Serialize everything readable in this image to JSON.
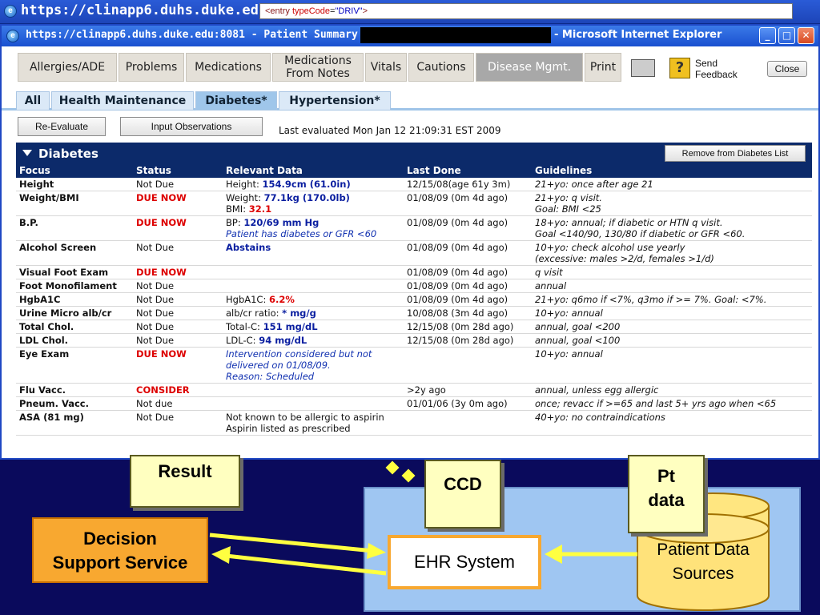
{
  "background_window": {
    "url": "https://clinapp6.duhs.duke.edu:808"
  },
  "tooltip": {
    "tag_open": "<entry",
    "attr": " typeCode",
    "equals": "=",
    "value": "\"DRIV\"",
    "tag_close": ">"
  },
  "window": {
    "title": "https://clinapp6.duhs.duke.edu:8081 - Patient Summary for",
    "title_suffix": "- Microsoft Internet Explorer"
  },
  "main_tabs": [
    "Allergies/ADE",
    "Problems",
    "Medications",
    "Medications From Notes",
    "Vitals",
    "Cautions",
    "Disease Mgmt.",
    "Print"
  ],
  "toolbar": {
    "send_feedback": "Send Feedback",
    "close": "Close"
  },
  "sub_tabs": [
    "All",
    "Health Maintenance",
    "Diabetes*",
    "Hypertension*"
  ],
  "actions": {
    "reevaluate": "Re-Evaluate",
    "input_observations": "Input Observations",
    "last_evaluated": "Last evaluated Mon Jan 12 21:09:31 EST 2009"
  },
  "panel": {
    "title": "Diabetes",
    "remove_button": "Remove from Diabetes List"
  },
  "table": {
    "headers": [
      "Focus",
      "Status",
      "Relevant Data",
      "Last Done",
      "Guidelines"
    ],
    "rows": [
      {
        "focus": "Height",
        "status": "Not Due",
        "due": false,
        "data1_label": "Height: ",
        "data1_value": "154.9cm (61.0in)",
        "data1_value_style": "bluebold",
        "data2_label": "",
        "data2_value": "",
        "data2_value_style": "",
        "last_done": "12/15/08(age 61y 3m)",
        "guide1": "21+yo: once after age 21",
        "guide2": ""
      },
      {
        "focus": "Weight/BMI",
        "status": "DUE NOW",
        "due": true,
        "data1_label": "Weight: ",
        "data1_value": "77.1kg (170.0lb)",
        "data1_value_style": "bluebold",
        "data2_label": "BMI: ",
        "data2_value": "32.1",
        "data2_value_style": "redbold",
        "last_done": "01/08/09 (0m 4d ago)",
        "guide1": "21+yo: q visit.",
        "guide2": "Goal: BMI <25"
      },
      {
        "focus": "B.P.",
        "status": "DUE NOW",
        "due": true,
        "data1_label": "BP: ",
        "data1_value": "120/69 mm Hg",
        "data1_value_style": "bluebold",
        "data2_label": "",
        "data2_value": "Patient has diabetes or GFR <60",
        "data2_value_style": "blueital",
        "last_done": "01/08/09 (0m 4d ago)",
        "guide1": "18+yo: annual; if diabetic or HTN q visit.",
        "guide2": "Goal <140/90, 130/80 if diabetic or GFR <60."
      },
      {
        "focus": "Alcohol Screen",
        "status": "Not Due",
        "due": false,
        "data1_label": "",
        "data1_value": "Abstains",
        "data1_value_style": "bluebold",
        "data2_label": "",
        "data2_value": "",
        "data2_value_style": "",
        "last_done": "01/08/09 (0m 4d ago)",
        "guide1": "10+yo: check alcohol use yearly",
        "guide2": "(excessive: males >2/d, females >1/d)"
      },
      {
        "focus": "Visual Foot Exam",
        "status": "DUE NOW",
        "due": true,
        "data1_label": "",
        "data1_value": "",
        "data1_value_style": "",
        "data2_label": "",
        "data2_value": "",
        "data2_value_style": "",
        "last_done": "01/08/09 (0m 4d ago)",
        "guide1": "q visit",
        "guide2": ""
      },
      {
        "focus": "Foot Monofilament",
        "status": "Not Due",
        "due": false,
        "data1_label": "",
        "data1_value": "",
        "data1_value_style": "",
        "data2_label": "",
        "data2_value": "",
        "data2_value_style": "",
        "last_done": "01/08/09 (0m 4d ago)",
        "guide1": "annual",
        "guide2": ""
      },
      {
        "focus": "HgbA1C",
        "status": "Not Due",
        "due": false,
        "data1_label": "HgbA1C: ",
        "data1_value": "6.2%",
        "data1_value_style": "redbold",
        "data2_label": "",
        "data2_value": "",
        "data2_value_style": "",
        "last_done": "01/08/09 (0m 4d ago)",
        "guide1": "21+yo: q6mo if <7%, q3mo if >= 7%. Goal: <7%.",
        "guide2": ""
      },
      {
        "focus": "Urine Micro alb/cr",
        "status": "Not Due",
        "due": false,
        "data1_label": "alb/cr ratio: ",
        "data1_value": "* mg/g",
        "data1_value_style": "bluebold",
        "data2_label": "",
        "data2_value": "",
        "data2_value_style": "",
        "last_done": "10/08/08 (3m 4d ago)",
        "guide1": "10+yo: annual",
        "guide2": ""
      },
      {
        "focus": "Total Chol.",
        "status": "Not Due",
        "due": false,
        "data1_label": "Total-C: ",
        "data1_value": "151 mg/dL",
        "data1_value_style": "bluebold",
        "data2_label": "",
        "data2_value": "",
        "data2_value_style": "",
        "last_done": "12/15/08 (0m 28d ago)",
        "guide1": "annual, goal <200",
        "guide2": ""
      },
      {
        "focus": "LDL Chol.",
        "status": "Not Due",
        "due": false,
        "data1_label": "LDL-C: ",
        "data1_value": "94 mg/dL",
        "data1_value_style": "bluebold",
        "data2_label": "",
        "data2_value": "",
        "data2_value_style": "",
        "last_done": "12/15/08 (0m 28d ago)",
        "guide1": "annual, goal <100",
        "guide2": ""
      },
      {
        "focus": "Eye Exam",
        "status": "DUE NOW",
        "due": true,
        "data1_label": "",
        "data1_value": "Intervention considered but not delivered on 01/08/09.",
        "data1_value_style": "blueital",
        "data2_label": "",
        "data2_value": "Reason: Scheduled",
        "data2_value_style": "blueital",
        "last_done": "",
        "guide1": "10+yo: annual",
        "guide2": ""
      },
      {
        "focus": "Flu Vacc.",
        "status": "CONSIDER",
        "due": true,
        "data1_label": "",
        "data1_value": "",
        "data1_value_style": "",
        "data2_label": "",
        "data2_value": "",
        "data2_value_style": "",
        "last_done": ">2y ago",
        "guide1": "annual, unless egg allergic",
        "guide2": ""
      },
      {
        "focus": "Pneum. Vacc.",
        "status": "Not due",
        "due": false,
        "data1_label": "",
        "data1_value": "",
        "data1_value_style": "",
        "data2_label": "",
        "data2_value": "",
        "data2_value_style": "",
        "last_done": "01/01/06 (3y 0m ago)",
        "guide1": "once; revacc if >=65 and last 5+ yrs ago when <65",
        "guide2": ""
      },
      {
        "focus": "ASA (81 mg)",
        "status": "Not Due",
        "due": false,
        "data1_label": "Not known to be allergic to aspirin",
        "data1_value": "",
        "data1_value_style": "",
        "data2_label": "Aspirin listed as prescribed",
        "data2_value": "",
        "data2_value_style": "",
        "last_done": "",
        "guide1": "40+yo: no contraindications",
        "guide2": ""
      }
    ]
  },
  "diagram": {
    "result": "Result",
    "ccd": "CCD",
    "pt_data_1": "Pt",
    "pt_data_2": "data",
    "dss_1": "Decision",
    "dss_2": "Support Service",
    "ehr": "EHR System",
    "pds_1": "Patient Data",
    "pds_2": "Sources"
  }
}
